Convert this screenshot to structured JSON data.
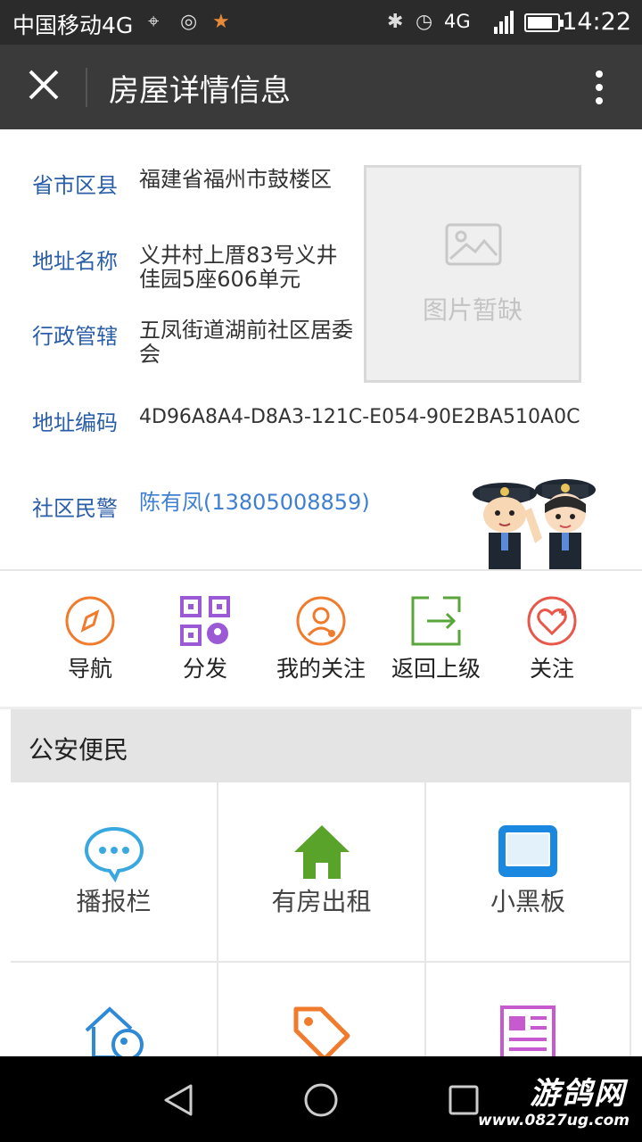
{
  "status_bar": {
    "carrier": "中国移动4G",
    "network": "4G",
    "time": "14:22"
  },
  "title_bar": {
    "title": "房屋详情信息"
  },
  "info": {
    "province_label": "省市区县",
    "province_value": "福建省福州市鼓楼区",
    "address_label": "地址名称",
    "address_value": "义井村上厝83号义井佳园5座606单元",
    "admin_label": "行政管辖",
    "admin_value": "五凤街道湖前社区居委会",
    "code_label": "地址编码",
    "code_value": "4D96A8A4-D8A3-121C-E054-90E2BA510A0C",
    "police_label": "社区民警",
    "police_value": "陈有凤(13805008859)",
    "image_placeholder": "图片暂缺"
  },
  "actions": [
    {
      "label": "导航",
      "icon": "compass-icon",
      "color": "#f07b2c"
    },
    {
      "label": "分发",
      "icon": "qrcode-icon",
      "color": "#9b59d6"
    },
    {
      "label": "我的关注",
      "icon": "user-heart-icon",
      "color": "#f07b2c"
    },
    {
      "label": "返回上级",
      "icon": "exit-icon",
      "color": "#5aa63a"
    },
    {
      "label": "关注",
      "icon": "heart-plus-icon",
      "color": "#e8584a"
    }
  ],
  "section": {
    "title": "公安便民",
    "items": [
      {
        "label": "播报栏",
        "icon": "chat-bubble-icon",
        "color": "#3aa8e0"
      },
      {
        "label": "有房出租",
        "icon": "house-icon",
        "color": "#5aa32a"
      },
      {
        "label": "小黑板",
        "icon": "blackboard-icon",
        "color": "#1a88e0"
      },
      {
        "label": "",
        "icon": "house-key-icon",
        "color": "#2e89d6"
      },
      {
        "label": "",
        "icon": "tag-icon",
        "color": "#f07b2c"
      },
      {
        "label": "",
        "icon": "newspaper-icon",
        "color": "#c85ad0"
      }
    ]
  },
  "watermark": {
    "name": "游鸽网",
    "url": "www.0827ug.com"
  }
}
